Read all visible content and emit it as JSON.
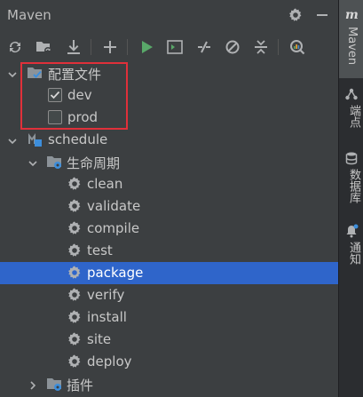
{
  "header": {
    "title": "Maven",
    "settings_icon": "gear-icon",
    "hide_icon": "minimize-icon"
  },
  "toolbar": {
    "buttons": [
      "reload-icon",
      "reimport-folder-icon",
      "download-icon",
      "add-icon",
      "run-icon",
      "execute-goal-icon",
      "toggle-offline-icon",
      "skip-tests-icon",
      "collapse-all-icon",
      "analyze-dependencies-icon"
    ]
  },
  "tree": {
    "profiles": {
      "label": "配置文件",
      "items": [
        {
          "label": "dev",
          "checked": true
        },
        {
          "label": "prod",
          "checked": false
        }
      ]
    },
    "project": {
      "label": "schedule"
    },
    "lifecycle": {
      "label": "生命周期",
      "goals": [
        "clean",
        "validate",
        "compile",
        "test",
        "package",
        "verify",
        "install",
        "site",
        "deploy"
      ],
      "selected": "package"
    },
    "plugins": {
      "label": "插件"
    }
  },
  "right_bar": {
    "items": [
      {
        "label": "Maven",
        "icon": "maven-m-icon"
      },
      {
        "label": "端点",
        "icon": "endpoints-icon"
      },
      {
        "label": "数据库",
        "icon": "database-icon"
      },
      {
        "label": "通知",
        "icon": "bell-icon"
      }
    ]
  },
  "colors": {
    "selection": "#2f65ca",
    "highlight_box": "#e0303a",
    "run_green": "#59a869"
  }
}
